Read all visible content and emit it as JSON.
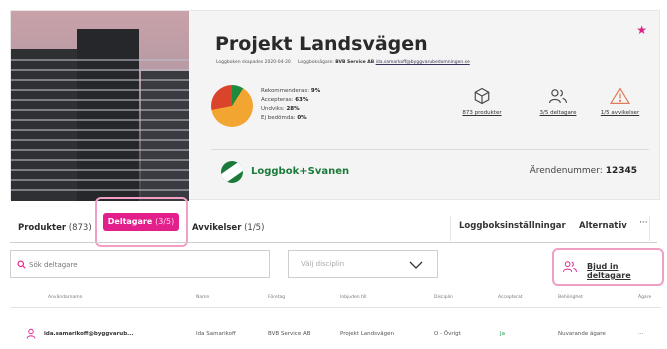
{
  "project": {
    "title": "Projekt Landsvägen",
    "created_label": "Loggboken skapades 2020-04-20",
    "owner_label": "Loggboksägare:",
    "owner_company": "BVB Service AB",
    "owner_email": "ida.samarkoff@byggvarubedomningen.se",
    "favorite_icon": "star-icon",
    "accent_color": "#e31f8c"
  },
  "summary": {
    "items": [
      {
        "label": "Rekommenderas:",
        "value": "9%",
        "color": "#1e8a3c"
      },
      {
        "label": "Accepteras:",
        "value": "63%",
        "color": "#f2a531"
      },
      {
        "label": "Undviks:",
        "value": "28%",
        "color": "#d9442a"
      },
      {
        "label": "Ej bedömda:",
        "value": "0%",
        "color": "#9a9a9a"
      }
    ]
  },
  "stats": {
    "products": "873 produkter",
    "participants": "3/5 deltagare",
    "deviations": "1/5 avvikelser"
  },
  "logbook": {
    "label": "Loggbok+Svanen",
    "case_label": "Ärendenummer:",
    "case_number": "12345"
  },
  "tabs": {
    "products": "Produkter",
    "products_count": "(873)",
    "participants": "Deltagare",
    "participants_count": "(3/5)",
    "deviations": "Avvikelser",
    "deviations_count": "(1/5)",
    "settings": "Loggboksinställningar",
    "options": "Alternativ"
  },
  "toolbar": {
    "search_placeholder": "Sök deltagare",
    "discipline_placeholder": "Välj disciplin",
    "invite_label": "Bjud in deltagare"
  },
  "table": {
    "columns": [
      "Användarnamn",
      "Namn",
      "Företag",
      "Inbjuden till",
      "Disciplin",
      "Accepterat",
      "Behörighet",
      "Ägare"
    ],
    "rows": [
      {
        "username": "ida.samarikoff@byggvarub...",
        "name": "Ida Samarikoff",
        "company": "BVB Service AB",
        "invited_to": "Projekt Landsvägen",
        "discipline": "O - Övrigt",
        "accepted": "Ja",
        "permission": "Nuvarande ägare",
        "owner": "···"
      }
    ]
  }
}
